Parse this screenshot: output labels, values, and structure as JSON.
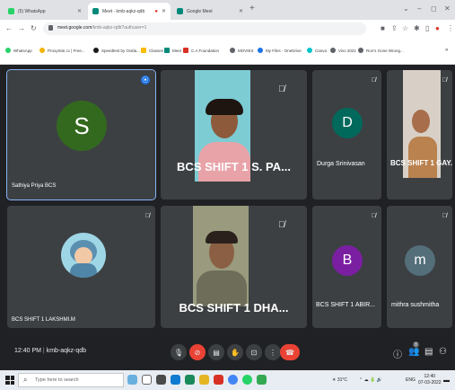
{
  "browser": {
    "tabs": [
      {
        "label": "(5) WhatsApp",
        "active": false,
        "color": "#25d366"
      },
      {
        "label": "Meet - kmb-aqkz-qdb",
        "active": true,
        "color": "#00897b"
      },
      {
        "label": "Google Meet",
        "active": false,
        "color": "#00897b"
      }
    ],
    "url_host": "meet.google.com",
    "url_path": "/kmb-aqkz-qdb?authuser=1",
    "bookmarks": [
      {
        "label": "WhatsApp",
        "color": "#25d366"
      },
      {
        "label": "ProxySite.cc | Free...",
        "color": "#f4b400"
      },
      {
        "label": "Speedtest by Ookla...",
        "color": "#1a1a1a"
      },
      {
        "label": "Classes",
        "color": "#fbbc04"
      },
      {
        "label": "Meet",
        "color": "#00897b"
      },
      {
        "label": "C.A Foundation",
        "color": "#d93025"
      },
      {
        "label": "MOVIES",
        "color": "#5f6368"
      },
      {
        "label": "My Files - OneDrive",
        "color": "#1a73e8"
      },
      {
        "label": "Canva",
        "color": "#00c4cc"
      },
      {
        "label": "Vivo 2021",
        "color": "#5f6368"
      },
      {
        "label": "Ron's Gone Wrong...",
        "color": "#5f6368"
      }
    ]
  },
  "participants": [
    {
      "name": "Sathiya Priya BCS",
      "initial": "S",
      "avatar_color": "#33691e"
    },
    {
      "name": "BCS SHIFT 1 S. PA..."
    },
    {
      "name": "Durga Srinivasan",
      "initial": "D",
      "avatar_color": "#00695c"
    },
    {
      "name": "BCS SHIFT 1 GAY..."
    },
    {
      "name": "BCS SHIFT 1 LAKSHMI.M"
    },
    {
      "name": "BCS SHIFT 1 DHA..."
    },
    {
      "name": "BCS SHIFT 1 ABIR...",
      "initial": "B",
      "avatar_color": "#7b1fa2"
    },
    {
      "name": "mithra sushmitha",
      "initial": "m",
      "avatar_color": "#546e7a"
    }
  ],
  "meeting": {
    "time": "12:40 PM",
    "code": "kmb-aqkz-qdb",
    "people_count": "8"
  },
  "taskbar": {
    "search_placeholder": "Type here to search",
    "weather": "31°C",
    "lang": "ENG",
    "time": "12:40",
    "date": "07-03-2022"
  }
}
